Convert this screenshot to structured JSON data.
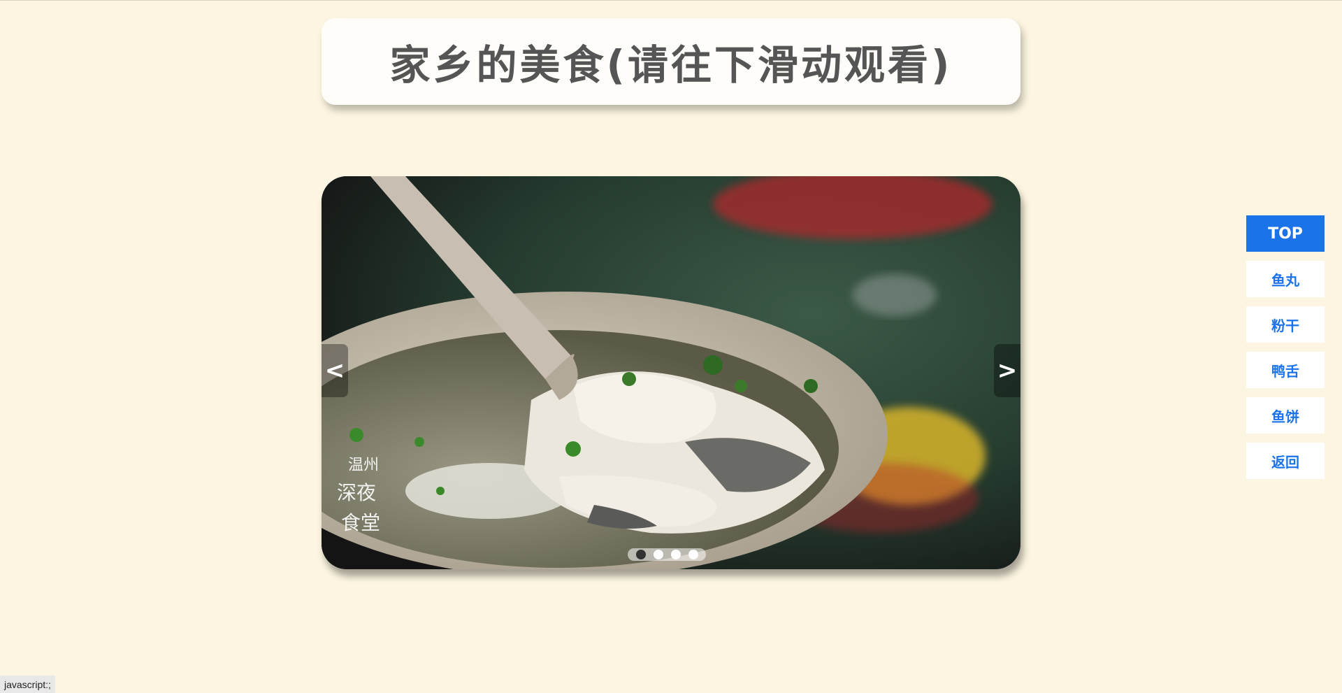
{
  "header": {
    "title": "家乡的美食(请往下滑动观看)"
  },
  "carousel": {
    "prev_label": "<",
    "next_label": ">",
    "slides": 4,
    "active_slide": 1,
    "watermark": "温州深夜食堂"
  },
  "side_nav": {
    "items": [
      {
        "label": "TOP"
      },
      {
        "label": "鱼丸"
      },
      {
        "label": "粉干"
      },
      {
        "label": "鸭舌"
      },
      {
        "label": "鱼饼"
      },
      {
        "label": "返回"
      }
    ]
  },
  "status_bar": {
    "text": "javascript:;"
  },
  "colors": {
    "page_bg": "#fcf5e1",
    "accent": "#1a73e8"
  }
}
